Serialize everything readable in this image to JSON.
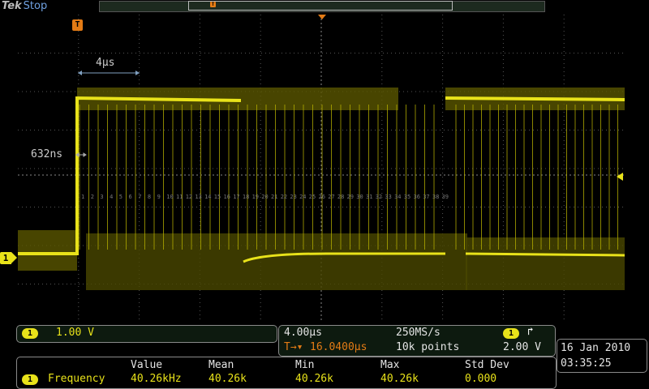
{
  "header": {
    "brand": "Tek",
    "status": "Stop"
  },
  "trigger": {
    "marker": "T"
  },
  "cursor": {
    "label": "4μs"
  },
  "pulse": {
    "label": "632ns"
  },
  "channel": {
    "number": "1",
    "scale": "1.00 V",
    "trace_color": "#e8e21a"
  },
  "timebase": {
    "scale": "4.00μs",
    "sample_rate": "250MS/s",
    "position": "16.0400μs",
    "record_length": "10k points",
    "trig_channel": "1",
    "trig_level": "2.00 V",
    "trig_prefix": "T→▾"
  },
  "datetime": {
    "date": "16 Jan  2010",
    "time": "03:35:25"
  },
  "measurement": {
    "headers": [
      "Value",
      "Mean",
      "Min",
      "Max",
      "Std Dev"
    ],
    "channel": "1",
    "name": "Frequency",
    "values": [
      "40.26kHz",
      "40.26k",
      "40.26k",
      "40.26k",
      "0.000"
    ]
  },
  "edge_labels": [
    "1",
    "2",
    "3",
    "4",
    "5",
    "6",
    "7",
    "8",
    "9",
    "10",
    "11",
    "12",
    "13",
    "14",
    "15",
    "16",
    "17",
    "18",
    "19",
    "20",
    "21",
    "22",
    "23",
    "24",
    "25",
    "26",
    "27",
    "28",
    "29",
    "30",
    "31",
    "32",
    "33",
    "34",
    "35",
    "36",
    "37",
    "38",
    "39"
  ],
  "colors": {
    "trace": "#e8e21a",
    "trigger": "#e37b15",
    "grid": "#555555",
    "panel_border": "#8a8a8a"
  }
}
